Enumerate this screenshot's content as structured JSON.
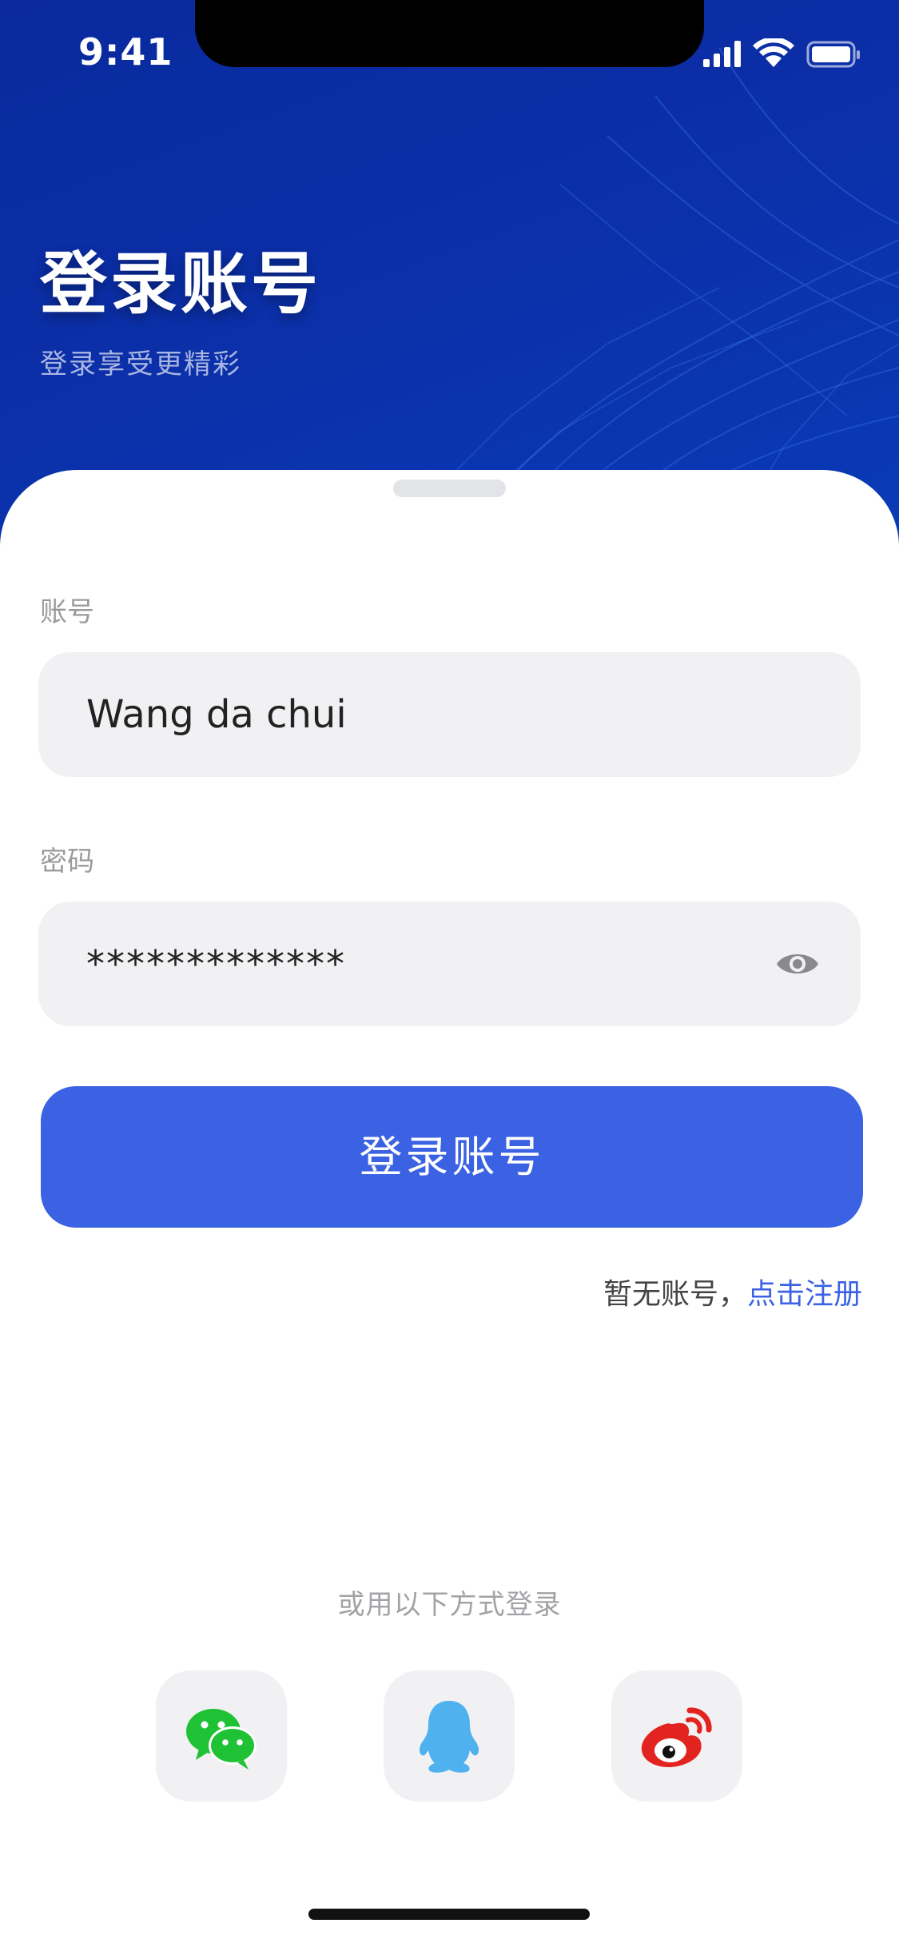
{
  "status_bar": {
    "time": "9:41",
    "icons": [
      "signal-icon",
      "wifi-icon",
      "battery-icon"
    ]
  },
  "header": {
    "title": "登录账号",
    "subtitle": "登录享受更精彩"
  },
  "form": {
    "account": {
      "label": "账号",
      "value": "Wang da chui"
    },
    "password": {
      "label": "密码",
      "value": "*************",
      "toggle_icon": "eye-icon"
    },
    "submit_label": "登录账号"
  },
  "register": {
    "prompt": "暂无账号，",
    "link": "点击注册"
  },
  "social_login": {
    "label": "或用以下方式登录",
    "providers": [
      {
        "name": "WeChat",
        "icon": "wechat-icon",
        "color": "#1fc234"
      },
      {
        "name": "QQ",
        "icon": "qq-icon",
        "color": "#4fb1ee"
      },
      {
        "name": "Weibo",
        "icon": "weibo-icon",
        "color": "#e3231f"
      }
    ]
  },
  "colors": {
    "header_bg": "#0b2fa8",
    "primary": "#3b62e3",
    "input_bg": "#f1f1f3",
    "label_gray": "#9a9a9e"
  }
}
